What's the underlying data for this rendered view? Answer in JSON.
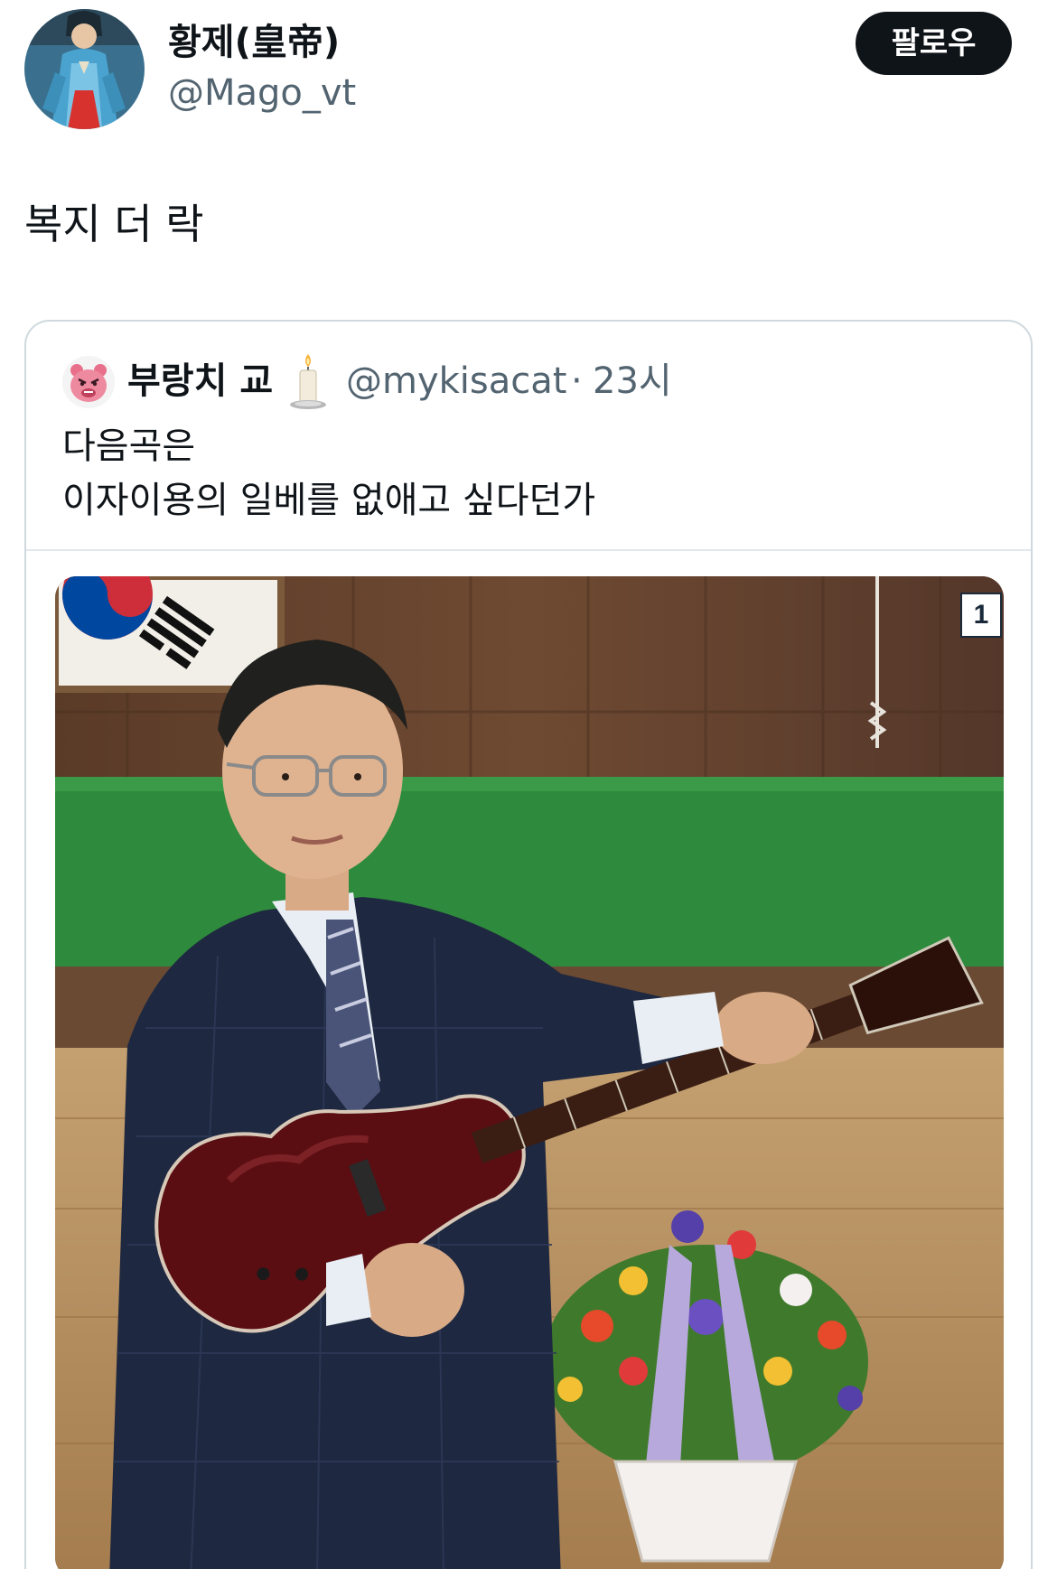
{
  "tweet": {
    "author": {
      "display_name": "황제(皇帝)",
      "handle": "@Mago_vt",
      "avatar_icon": "avatar-hanbok-figure-icon"
    },
    "follow_label": "팔로우",
    "text": "복지 더 락"
  },
  "quoted_tweet": {
    "author": {
      "display_name": "부랑치 교",
      "name_emoji_icon": "candle-icon",
      "handle": "@mykisacat",
      "separator": "·",
      "time": "23시",
      "avatar_icon": "angry-pink-bear-icon"
    },
    "text_lines": [
      "다음곡은",
      "이자이용의 일베를 없애고 싶다던가"
    ],
    "photo": {
      "badge": "1"
    }
  },
  "colors": {
    "text_primary": "#0f1419",
    "text_secondary": "#536471",
    "follow_button_bg": "#0f1419",
    "card_border": "#cfd9de"
  }
}
